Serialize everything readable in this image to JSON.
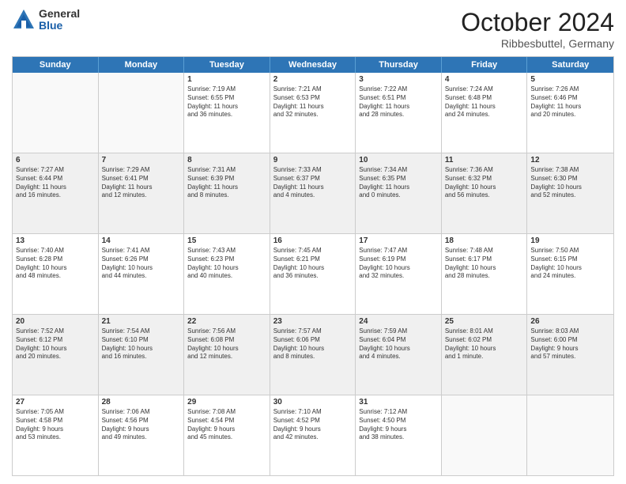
{
  "logo": {
    "general": "General",
    "blue": "Blue"
  },
  "title": {
    "month": "October 2024",
    "location": "Ribbesbuttel, Germany"
  },
  "header_days": [
    "Sunday",
    "Monday",
    "Tuesday",
    "Wednesday",
    "Thursday",
    "Friday",
    "Saturday"
  ],
  "rows": [
    {
      "cells": [
        {
          "day": "",
          "text": ""
        },
        {
          "day": "",
          "text": ""
        },
        {
          "day": "1",
          "text": "Sunrise: 7:19 AM\nSunset: 6:55 PM\nDaylight: 11 hours\nand 36 minutes."
        },
        {
          "day": "2",
          "text": "Sunrise: 7:21 AM\nSunset: 6:53 PM\nDaylight: 11 hours\nand 32 minutes."
        },
        {
          "day": "3",
          "text": "Sunrise: 7:22 AM\nSunset: 6:51 PM\nDaylight: 11 hours\nand 28 minutes."
        },
        {
          "day": "4",
          "text": "Sunrise: 7:24 AM\nSunset: 6:48 PM\nDaylight: 11 hours\nand 24 minutes."
        },
        {
          "day": "5",
          "text": "Sunrise: 7:26 AM\nSunset: 6:46 PM\nDaylight: 11 hours\nand 20 minutes."
        }
      ]
    },
    {
      "cells": [
        {
          "day": "6",
          "text": "Sunrise: 7:27 AM\nSunset: 6:44 PM\nDaylight: 11 hours\nand 16 minutes."
        },
        {
          "day": "7",
          "text": "Sunrise: 7:29 AM\nSunset: 6:41 PM\nDaylight: 11 hours\nand 12 minutes."
        },
        {
          "day": "8",
          "text": "Sunrise: 7:31 AM\nSunset: 6:39 PM\nDaylight: 11 hours\nand 8 minutes."
        },
        {
          "day": "9",
          "text": "Sunrise: 7:33 AM\nSunset: 6:37 PM\nDaylight: 11 hours\nand 4 minutes."
        },
        {
          "day": "10",
          "text": "Sunrise: 7:34 AM\nSunset: 6:35 PM\nDaylight: 11 hours\nand 0 minutes."
        },
        {
          "day": "11",
          "text": "Sunrise: 7:36 AM\nSunset: 6:32 PM\nDaylight: 10 hours\nand 56 minutes."
        },
        {
          "day": "12",
          "text": "Sunrise: 7:38 AM\nSunset: 6:30 PM\nDaylight: 10 hours\nand 52 minutes."
        }
      ]
    },
    {
      "cells": [
        {
          "day": "13",
          "text": "Sunrise: 7:40 AM\nSunset: 6:28 PM\nDaylight: 10 hours\nand 48 minutes."
        },
        {
          "day": "14",
          "text": "Sunrise: 7:41 AM\nSunset: 6:26 PM\nDaylight: 10 hours\nand 44 minutes."
        },
        {
          "day": "15",
          "text": "Sunrise: 7:43 AM\nSunset: 6:23 PM\nDaylight: 10 hours\nand 40 minutes."
        },
        {
          "day": "16",
          "text": "Sunrise: 7:45 AM\nSunset: 6:21 PM\nDaylight: 10 hours\nand 36 minutes."
        },
        {
          "day": "17",
          "text": "Sunrise: 7:47 AM\nSunset: 6:19 PM\nDaylight: 10 hours\nand 32 minutes."
        },
        {
          "day": "18",
          "text": "Sunrise: 7:48 AM\nSunset: 6:17 PM\nDaylight: 10 hours\nand 28 minutes."
        },
        {
          "day": "19",
          "text": "Sunrise: 7:50 AM\nSunset: 6:15 PM\nDaylight: 10 hours\nand 24 minutes."
        }
      ]
    },
    {
      "cells": [
        {
          "day": "20",
          "text": "Sunrise: 7:52 AM\nSunset: 6:12 PM\nDaylight: 10 hours\nand 20 minutes."
        },
        {
          "day": "21",
          "text": "Sunrise: 7:54 AM\nSunset: 6:10 PM\nDaylight: 10 hours\nand 16 minutes."
        },
        {
          "day": "22",
          "text": "Sunrise: 7:56 AM\nSunset: 6:08 PM\nDaylight: 10 hours\nand 12 minutes."
        },
        {
          "day": "23",
          "text": "Sunrise: 7:57 AM\nSunset: 6:06 PM\nDaylight: 10 hours\nand 8 minutes."
        },
        {
          "day": "24",
          "text": "Sunrise: 7:59 AM\nSunset: 6:04 PM\nDaylight: 10 hours\nand 4 minutes."
        },
        {
          "day": "25",
          "text": "Sunrise: 8:01 AM\nSunset: 6:02 PM\nDaylight: 10 hours\nand 1 minute."
        },
        {
          "day": "26",
          "text": "Sunrise: 8:03 AM\nSunset: 6:00 PM\nDaylight: 9 hours\nand 57 minutes."
        }
      ]
    },
    {
      "cells": [
        {
          "day": "27",
          "text": "Sunrise: 7:05 AM\nSunset: 4:58 PM\nDaylight: 9 hours\nand 53 minutes."
        },
        {
          "day": "28",
          "text": "Sunrise: 7:06 AM\nSunset: 4:56 PM\nDaylight: 9 hours\nand 49 minutes."
        },
        {
          "day": "29",
          "text": "Sunrise: 7:08 AM\nSunset: 4:54 PM\nDaylight: 9 hours\nand 45 minutes."
        },
        {
          "day": "30",
          "text": "Sunrise: 7:10 AM\nSunset: 4:52 PM\nDaylight: 9 hours\nand 42 minutes."
        },
        {
          "day": "31",
          "text": "Sunrise: 7:12 AM\nSunset: 4:50 PM\nDaylight: 9 hours\nand 38 minutes."
        },
        {
          "day": "",
          "text": ""
        },
        {
          "day": "",
          "text": ""
        }
      ]
    }
  ]
}
